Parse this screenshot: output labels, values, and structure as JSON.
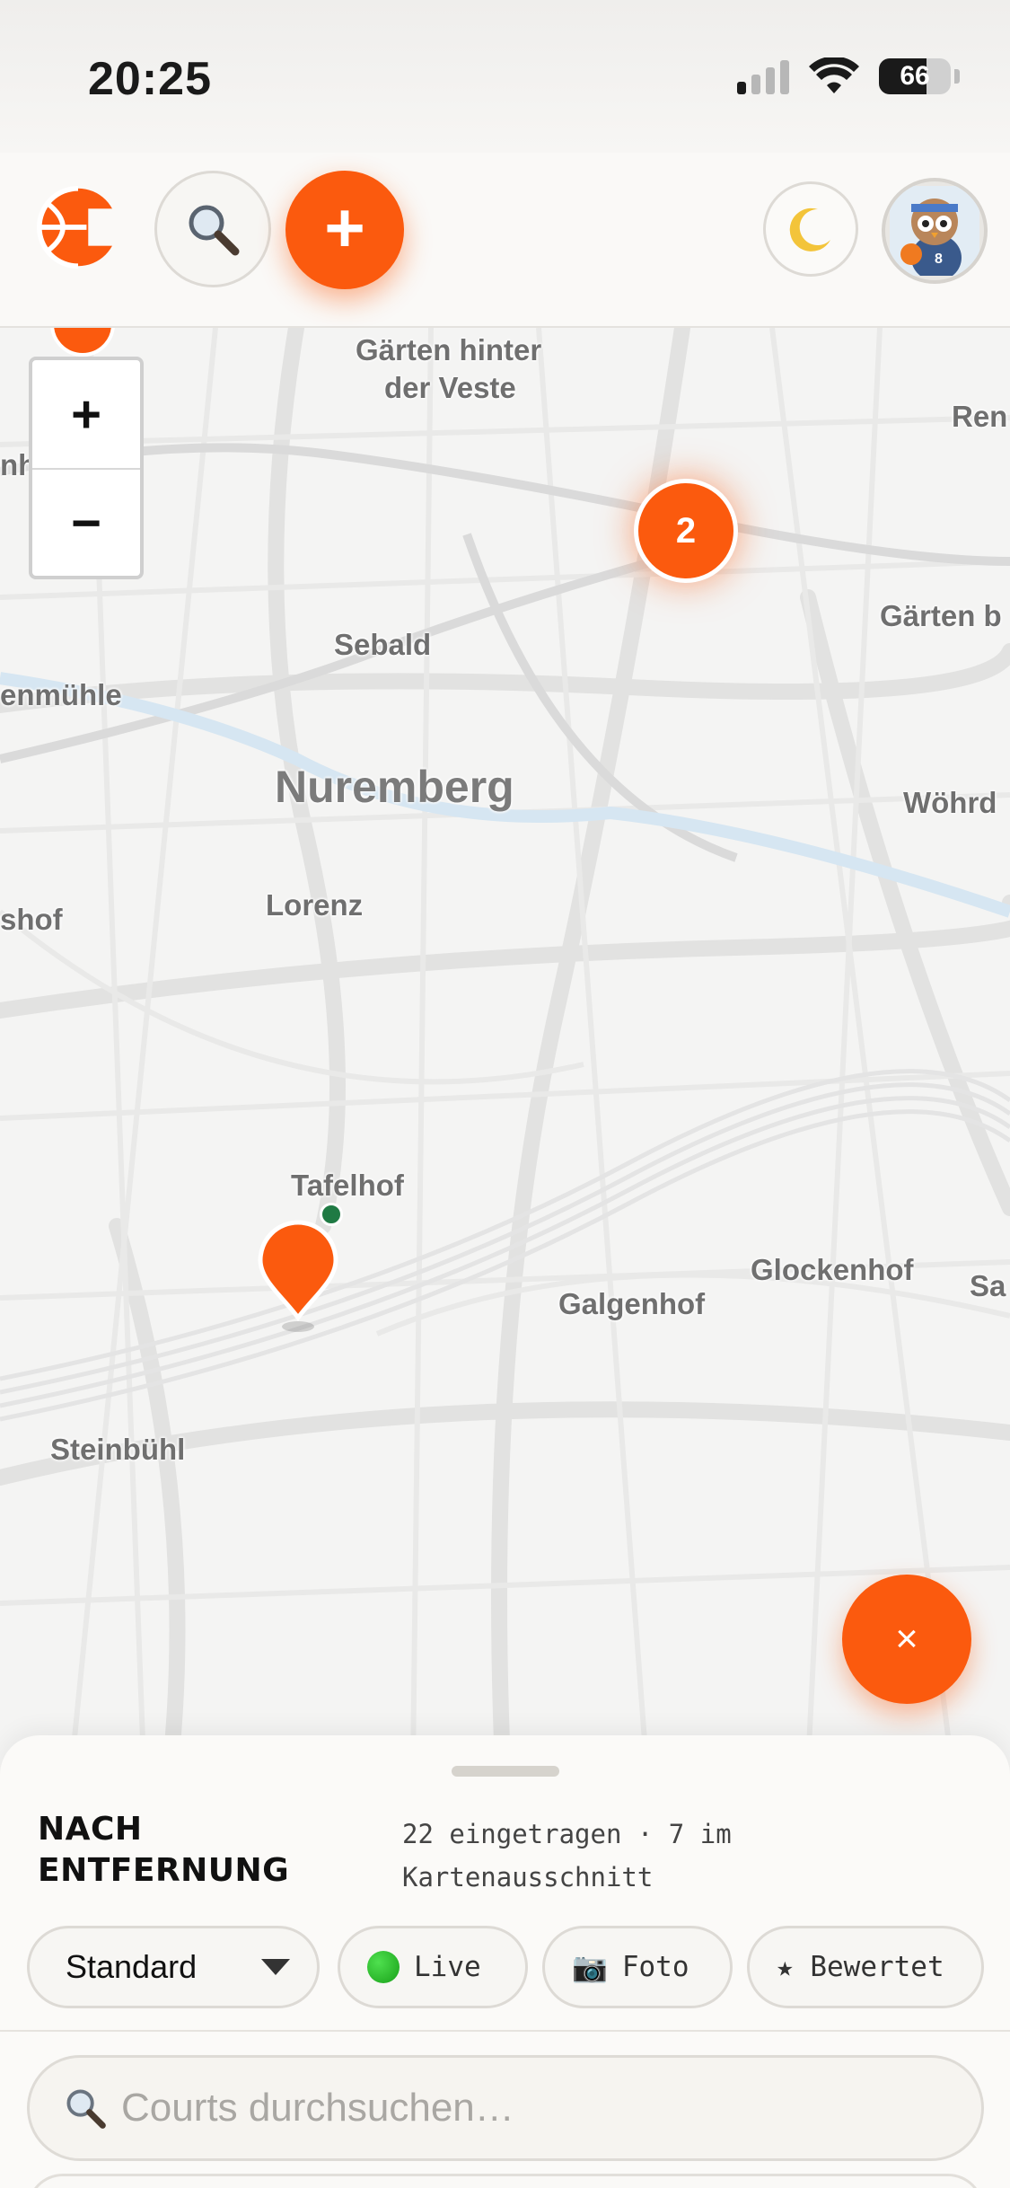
{
  "status_bar": {
    "time": "20:25",
    "battery_level": 66,
    "battery_text": "66",
    "signal_bars": 1
  },
  "toolbar": {
    "logo_icon": "basketball-logo-icon",
    "search_icon": "magnifier-icon",
    "add_label": "+",
    "moon_icon": "crescent-moon-icon",
    "avatar_icon": "owl-basketball-avatar"
  },
  "map": {
    "zoom_in_label": "+",
    "zoom_out_label": "−",
    "cluster_count": "2",
    "close_label": "×",
    "labels": {
      "gaerten_hinter_1": "Gärten hinter",
      "gaerten_hinter_2": "der Veste",
      "ren": "Ren",
      "gaerten_b": "Gärten b",
      "sebald": "Sebald",
      "enmuehle": "enmühle",
      "nuremberg": "Nuremberg",
      "woehrd": "Wöhrd",
      "shof": "shof",
      "lorenz": "Lorenz",
      "tafelhof": "Tafelhof",
      "glockenhof": "Glockenhof",
      "galgenhof": "Galgenhof",
      "sa": "Sa",
      "steinbuehl": "Steinbühl",
      "nh": "nh"
    },
    "accent_color": "#fb5a0e",
    "live_color": "#1f7a44"
  },
  "sheet": {
    "title_line1": "NACH",
    "title_line2": "ENTFERNUNG",
    "meta_line1": "22 eingetragen · 7 im",
    "meta_line2": "Kartenausschnitt",
    "filters": {
      "sort_value": "Standard",
      "live": "Live",
      "foto_icon": "📷",
      "foto": "Foto",
      "rated": "★ Bewertet"
    },
    "search_placeholder": "Courts durchsuchen…"
  }
}
